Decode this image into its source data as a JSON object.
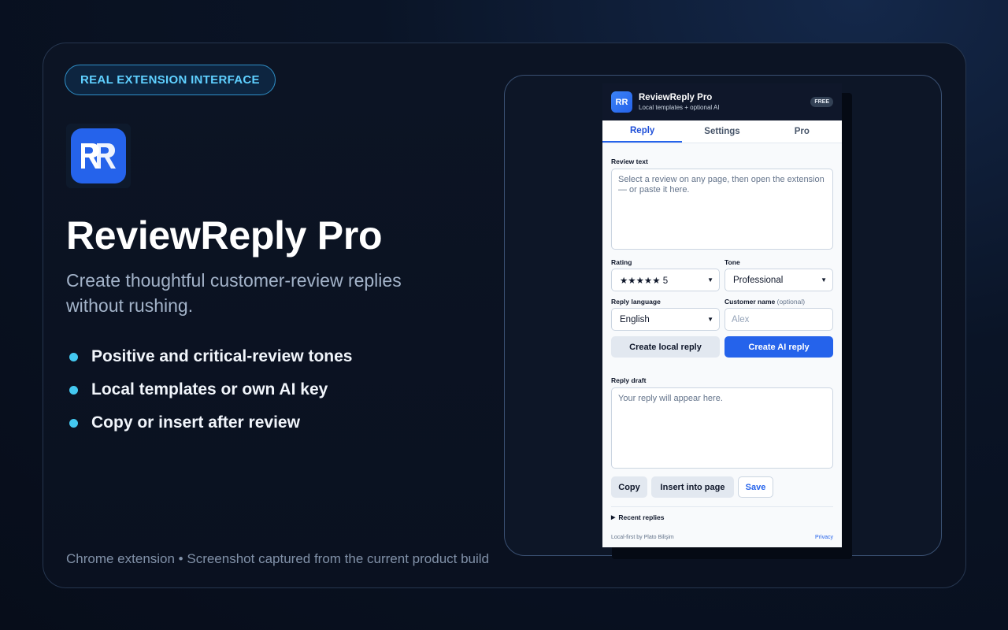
{
  "badge": "REAL EXTENSION INTERFACE",
  "hero": {
    "title": "ReviewReply Pro",
    "subtitle": "Create thoughtful customer-review replies without rushing.",
    "features": [
      "Positive and critical-review tones",
      "Local templates or own AI key",
      "Copy or insert after review"
    ],
    "footnote": "Chrome extension • Screenshot captured from the current product build"
  },
  "popup": {
    "logo_text": "RR",
    "app_name": "ReviewReply Pro",
    "app_tagline": "Local templates + optional AI",
    "plan_badge": "FREE",
    "tabs": [
      {
        "label": "Reply",
        "active": true
      },
      {
        "label": "Settings",
        "active": false
      },
      {
        "label": "Pro",
        "active": false
      }
    ],
    "review_label": "Review text",
    "review_placeholder": "Select a review on any page, then open the extension — or paste it here.",
    "rating_label": "Rating",
    "rating_value": "★★★★★ 5",
    "tone_label": "Tone",
    "tone_value": "Professional",
    "language_label": "Reply language",
    "language_value": "English",
    "customer_label": "Customer name",
    "customer_optional": "(optional)",
    "customer_placeholder": "Alex",
    "local_button": "Create local reply",
    "ai_button": "Create AI reply",
    "draft_label": "Reply draft",
    "draft_placeholder": "Your reply will appear here.",
    "copy_button": "Copy",
    "insert_button": "Insert into page",
    "save_button": "Save",
    "recent_label": "Recent replies",
    "footer_left": "Local-first by Plato Bilişim",
    "footer_right": "Privacy"
  },
  "colors": {
    "accent": "#2563eb",
    "badge_text": "#5fd0ff",
    "bullet": "#44c8f0"
  },
  "icons": {
    "logo": "rr-monogram-icon",
    "bullet": "dot-icon",
    "select_arrow": "chevron-down-icon",
    "disclosure": "triangle-right-icon"
  }
}
